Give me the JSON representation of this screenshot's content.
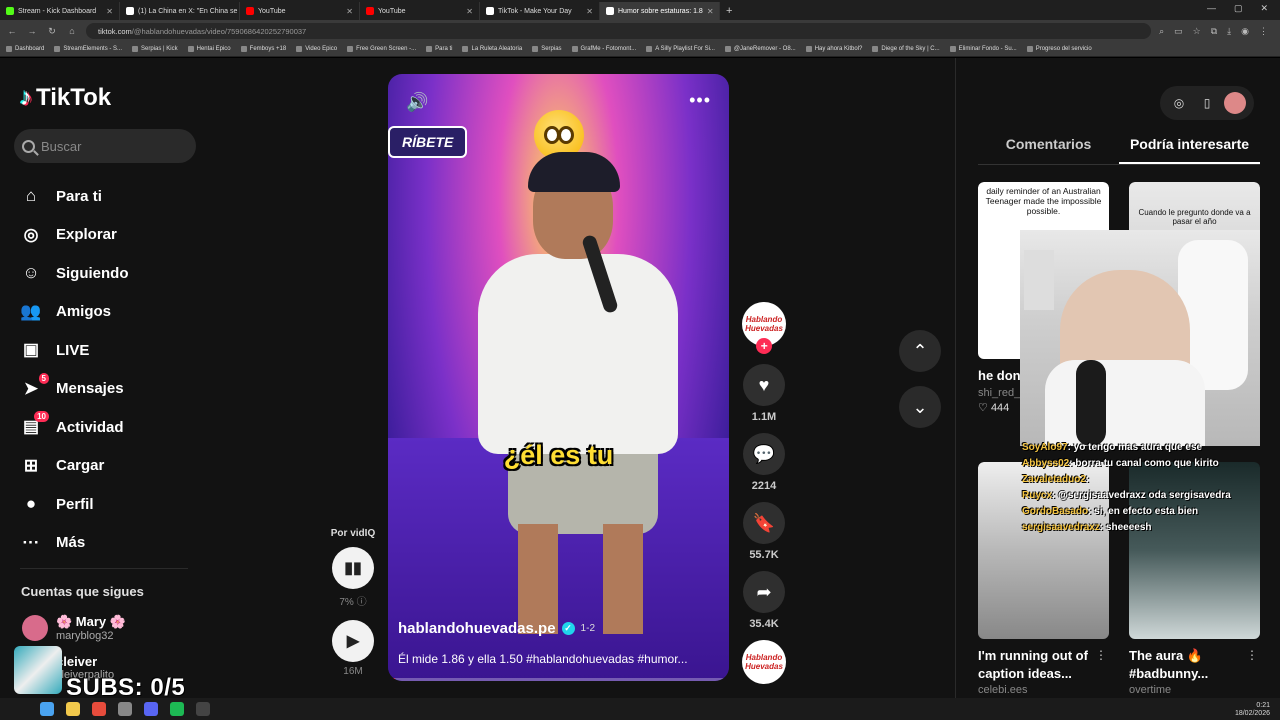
{
  "browser": {
    "tabs": [
      {
        "label": "Stream - Kick Dashboard",
        "color": "#53fc18"
      },
      {
        "label": "(1) La China en X: \"En China se",
        "color": "#fff"
      },
      {
        "label": "YouTube",
        "color": "#ff0000"
      },
      {
        "label": "YouTube",
        "color": "#ff0000"
      },
      {
        "label": "TikTok - Make Your Day",
        "color": "#fff"
      },
      {
        "label": "Humor sobre estaturas: 1.8",
        "color": "#fff",
        "active": true
      }
    ],
    "url_host": "tiktok.com",
    "url_path": "/@hablandohuevadas/video/7590686420252790037",
    "bookmarks": [
      "Dashboard",
      "StreamElements - S...",
      "Serpias | Kick",
      "Hentai Epico",
      "Femboys +18",
      "Video Epico",
      "Free Green Screen -...",
      "Para ti",
      "La Ruleta Aleatoria",
      "Serpias",
      "GrafMe - Fotomont...",
      "A Silly Playlist For Si...",
      "@JaneRemover - O8...",
      "Hay ahora Kitbol?",
      "Diege of the Sky | C...",
      "Eliminar Fondo - Su...",
      "Progreso del servicio"
    ]
  },
  "sidebar": {
    "logo": "TikTok",
    "search_placeholder": "Buscar",
    "items": [
      {
        "label": "Para ti",
        "icon": "home-icon",
        "glyph": "⌂"
      },
      {
        "label": "Explorar",
        "icon": "compass-icon",
        "glyph": "◎"
      },
      {
        "label": "Siguiendo",
        "icon": "following-icon",
        "glyph": "☺"
      },
      {
        "label": "Amigos",
        "icon": "friends-icon",
        "glyph": "👥"
      },
      {
        "label": "LIVE",
        "icon": "live-icon",
        "glyph": "▣"
      },
      {
        "label": "Mensajes",
        "icon": "messages-icon",
        "glyph": "➤",
        "badge": "5"
      },
      {
        "label": "Actividad",
        "icon": "activity-icon",
        "glyph": "▤",
        "badge": "10"
      },
      {
        "label": "Cargar",
        "icon": "upload-icon",
        "glyph": "⊞"
      },
      {
        "label": "Perfil",
        "icon": "profile-icon",
        "glyph": "●"
      },
      {
        "label": "Más",
        "icon": "more-icon",
        "glyph": "···"
      }
    ],
    "following_title": "Cuentas que sigues",
    "accounts": [
      {
        "name": "🌸 Mary 🌸",
        "user": "maryblog32"
      },
      {
        "name": "cleiver",
        "user": "cleiverpalito"
      }
    ]
  },
  "overlay": {
    "subs": "SUBS: 0/5"
  },
  "video": {
    "sign_text": "RÍBETE",
    "caption": "¿él es tu",
    "author": "hablandohuevadas.pe",
    "date": "1-2",
    "description": "Él mide 1.86 y ella 1.50 #hablandohuevadas #humor...",
    "progress_fraction": 0.02
  },
  "vidiq": {
    "title": "Por vidIQ",
    "percent": "7%",
    "views": "16M"
  },
  "actions": {
    "avatar_label": "Hablando Huevadas",
    "likes": "1.1M",
    "comments": "2214",
    "saves": "55.7K",
    "shares": "35.4K"
  },
  "right": {
    "tabs": [
      "Comentarios",
      "Podría interesarte"
    ],
    "cards": [
      {
        "overlay": "daily reminder of an Australian Teenager made the impossible possible.",
        "title": "he don...sleepin...",
        "user": "shi_red_",
        "stat": "444"
      },
      {
        "overlay": "Cuando le pregunto donde va a pasar el año",
        "title": "",
        "user": "",
        "stat": ""
      },
      {
        "overlay": "",
        "title": "I'm running out of caption ideas...",
        "user": "celebi.ees",
        "stat": ""
      },
      {
        "overlay": "",
        "title": "The aura 🔥 #badbunny...",
        "user": "overtime",
        "stat": ""
      }
    ]
  },
  "chat": [
    {
      "user": "SoyAlo97",
      "msg": ": yo tengo mas aura que ese"
    },
    {
      "user": "Abbyss02",
      "msg": ": borra tu canal como que kirito"
    },
    {
      "user": "Zavaletaduo2",
      "msg": ":"
    },
    {
      "user": "Ruycx",
      "msg": ": @sergisaavedraxz oda sergisavedra"
    },
    {
      "user": "GordoBasado",
      "msg": ": si, en efecto esta bien"
    },
    {
      "user": "sergisaavedraxz",
      "msg": ": sheeeesh"
    }
  ],
  "tray": {
    "time": "0:21",
    "date": "18/02/2026"
  },
  "colors": {
    "accent": "#fe2c55",
    "caption": "#ffde33"
  }
}
